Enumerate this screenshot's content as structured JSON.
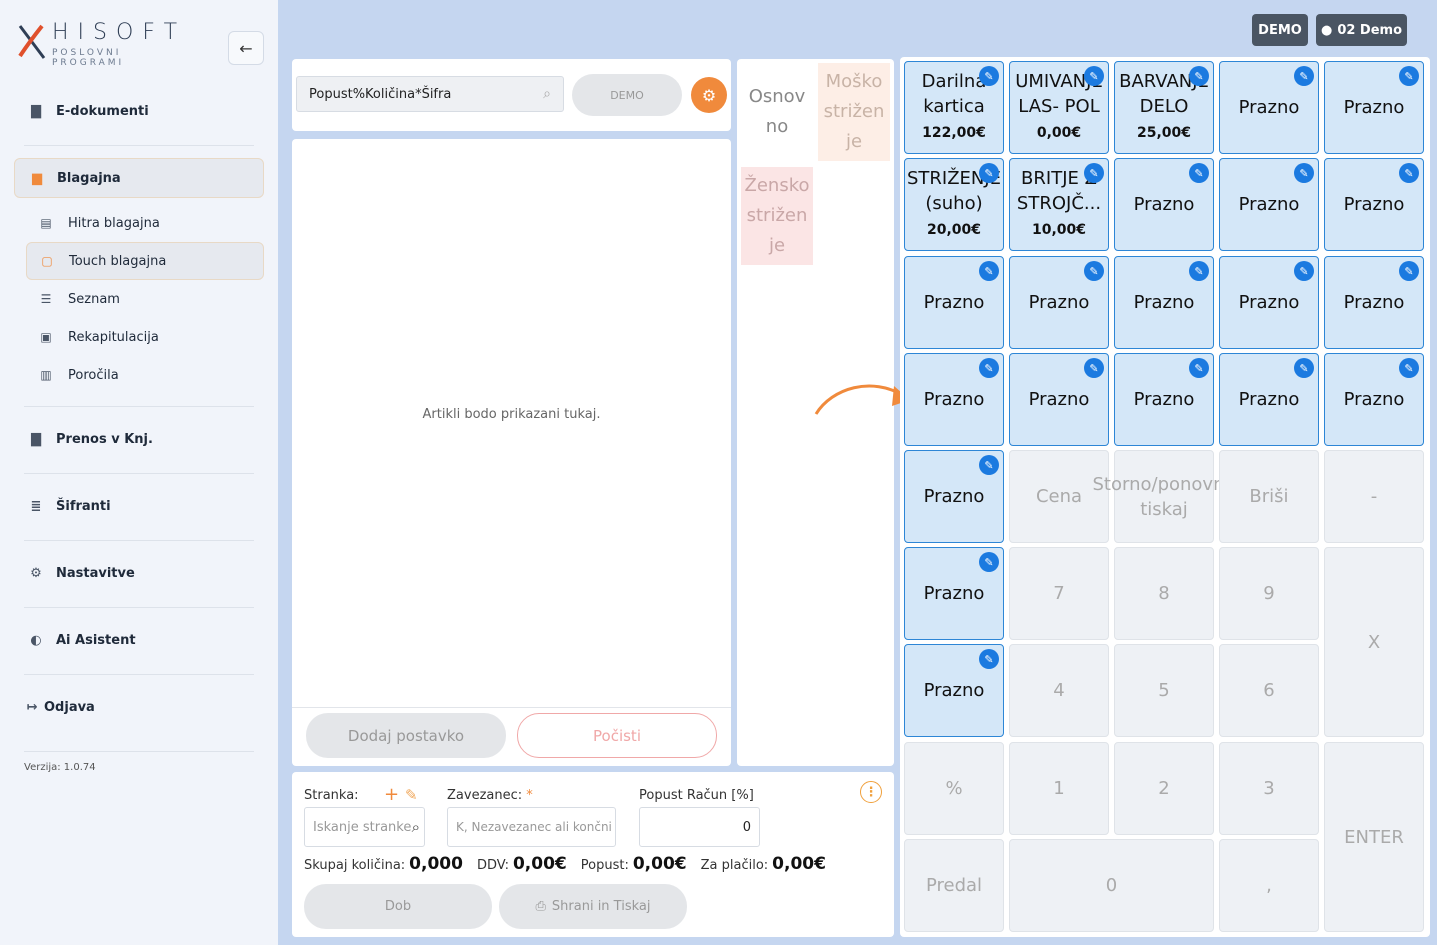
{
  "brand": {
    "name": "HISOFT",
    "tagline": "POSLOVNI PROGRAMI"
  },
  "header": {
    "badge_demo": "DEMO",
    "badge_user": "02 Demo"
  },
  "sidebar": {
    "edokumenti": "E-dokumenti",
    "blagajna": "Blagajna",
    "hitra": "Hitra blagajna",
    "touch": "Touch blagajna",
    "seznam": "Seznam",
    "rekap": "Rekapitulacija",
    "porocila": "Poročila",
    "prenos": "Prenos v Knj.",
    "sifranti": "Šifranti",
    "nastavitve": "Nastavitve",
    "ai": "Ai Asistent",
    "odjava": "Odjava",
    "version": "Verzija: 1.0.74"
  },
  "search": {
    "value": "Popust%Količina*Šifra",
    "demo_label": "DEMO"
  },
  "items_panel": {
    "empty_text": "Artikli bodo prikazani tukaj.",
    "add_label": "Dodaj postavko",
    "clear_label": "Počisti"
  },
  "categories": {
    "osnovno": "Osnov no",
    "mosko": "Moško strižen je",
    "zensko": "Žensko strižen je"
  },
  "customer": {
    "stranka_label": "Stranka:",
    "stranka_placeholder": "Iskanje stranke",
    "zavezanec_label": "Zavezanec:",
    "zavezanec_value": "K, Nezavezanec ali končni",
    "popust_label": "Popust Račun [%]",
    "popust_value": "0",
    "total_qty_label": "Skupaj količina:",
    "total_qty": "0,000",
    "ddv_label": "DDV:",
    "ddv": "0,00€",
    "discount_label": "Popust:",
    "discount": "0,00€",
    "pay_label": "Za plačilo:",
    "pay": "0,00€",
    "dob_label": "Dob",
    "save_label": "Shrani in Tiskaj"
  },
  "keys": {
    "k1": {
      "name": "Darilna kartica",
      "price": "122,00€"
    },
    "k2": {
      "name": "UMIVANJE LAS- POL",
      "price": "0,00€"
    },
    "k3": {
      "name": "BARVANJE DELO",
      "price": "25,00€"
    },
    "k6": {
      "name": "STRIŽENJE (suho)",
      "price": "20,00€"
    },
    "k7": {
      "name": "BRITJE Z STROJČ...",
      "price": "10,00€"
    },
    "empty": "Prazno",
    "cena": "Cena",
    "storno": "Storno/ponovno tiskaj",
    "brisi": "Briši",
    "minus": "-",
    "n7": "7",
    "n8": "8",
    "n9": "9",
    "x": "X",
    "n4": "4",
    "n5": "5",
    "n6": "6",
    "pct": "%",
    "n1": "1",
    "n2": "2",
    "n3": "3",
    "enter": "ENTER",
    "predal": "Predal",
    "n0": "0",
    "comma": ","
  }
}
